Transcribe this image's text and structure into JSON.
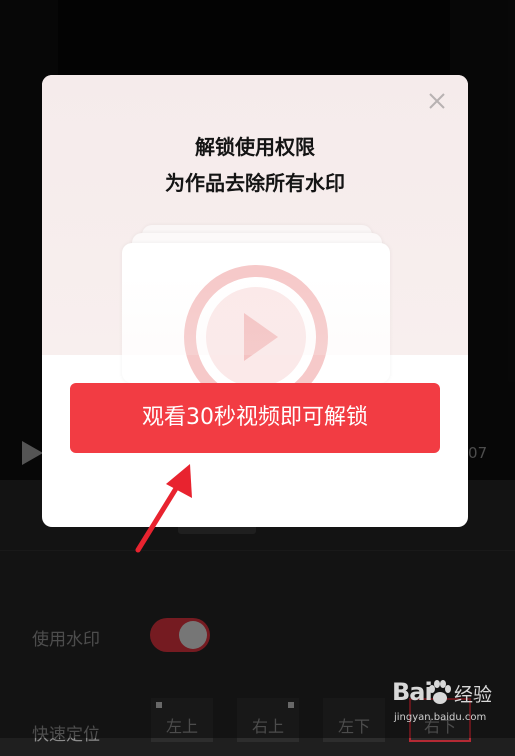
{
  "player": {
    "time": ":07"
  },
  "settings": {
    "watermark_label": "使用水印",
    "watermark_enabled": true,
    "position_label": "快速定位",
    "positions": [
      {
        "label": "左上",
        "selected": false
      },
      {
        "label": "右上",
        "selected": false
      },
      {
        "label": "左下",
        "selected": false
      },
      {
        "label": "右下",
        "selected": true
      }
    ]
  },
  "dialog": {
    "title_line1": "解锁使用权限",
    "title_line2": "为作品去除所有水印",
    "unlock_button": "观看30秒视频即可解锁",
    "close_icon": "close-icon",
    "illustration_icon": "play-circle-icon"
  },
  "watermark": {
    "brand": "Bai",
    "brand_cn": "经验",
    "url": "jingyan.baidu.com"
  },
  "colors": {
    "accent_red": "#f23c43",
    "toggle_on": "#d5323c",
    "annotation_arrow": "#e8232f"
  }
}
